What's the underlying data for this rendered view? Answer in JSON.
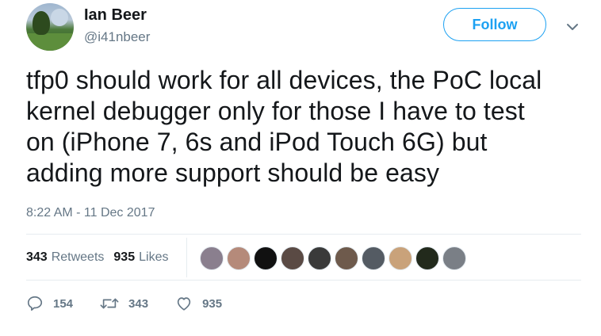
{
  "author": {
    "name": "Ian Beer",
    "handle": "@i41nbeer"
  },
  "follow_label": "Follow",
  "tweet": {
    "lines": [
      "tfp0 should work for all devices, the PoC local",
      "kernel debugger only for those I have to test",
      "on (iPhone 7, 6s and iPod Touch 6G) but",
      "adding more support should be easy"
    ],
    "timestamp": "8:22 AM - 11 Dec 2017"
  },
  "stats": {
    "retweets_count": "343",
    "retweets_label": "Retweets",
    "likes_count": "935",
    "likes_label": "Likes"
  },
  "liker_avatars": [
    {
      "color": "#8a7f8e"
    },
    {
      "color": "#b58a7a"
    },
    {
      "color": "#111111"
    },
    {
      "color": "#5a4a44"
    },
    {
      "color": "#3a3a3a"
    },
    {
      "color": "#6e5a4c"
    },
    {
      "color": "#545b63"
    },
    {
      "color": "#c9a27a"
    },
    {
      "color": "#222a1c"
    },
    {
      "color": "#7a7f86"
    }
  ],
  "actions": {
    "replies": "154",
    "retweets": "343",
    "likes": "935"
  },
  "colors": {
    "accent": "#1da1f2",
    "text": "#14171a",
    "muted": "#657786",
    "divider": "#e6ecf0"
  }
}
